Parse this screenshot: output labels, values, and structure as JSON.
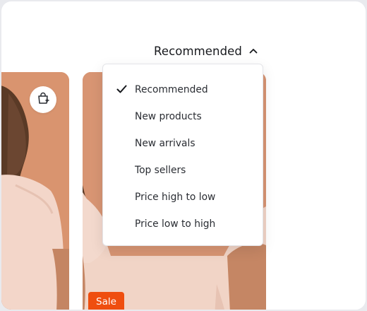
{
  "sort": {
    "current_label": "Recommended",
    "expanded": true,
    "trigger_icon": "chevron-up-icon"
  },
  "menu": {
    "selected_index": 0,
    "items": [
      {
        "label": "Recommended",
        "selected": true
      },
      {
        "label": "New products",
        "selected": false
      },
      {
        "label": "New arrivals",
        "selected": false
      },
      {
        "label": "Top sellers",
        "selected": false
      },
      {
        "label": "Price high to low",
        "selected": false
      },
      {
        "label": "Price low to high",
        "selected": false
      }
    ]
  },
  "cards": [
    {
      "icon": "shopping-bag-add-icon"
    },
    {
      "badge": "Sale"
    }
  ],
  "colors": {
    "accent": "#ef4e0f",
    "card_background": "#d89573",
    "text": "#17191d"
  }
}
